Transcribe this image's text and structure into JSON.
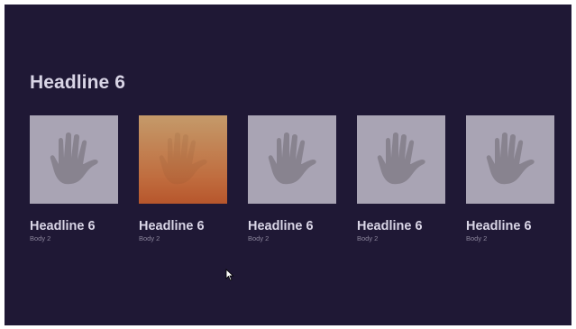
{
  "row": {
    "title": "Headline 6"
  },
  "cards": [
    {
      "title": "Headline 6",
      "body": "Body 2",
      "icon": "hand-icon",
      "focused": false
    },
    {
      "title": "Headline 6",
      "body": "Body 2",
      "icon": "hand-icon",
      "focused": true
    },
    {
      "title": "Headline 6",
      "body": "Body 2",
      "icon": "hand-icon",
      "focused": false
    },
    {
      "title": "Headline 6",
      "body": "Body 2",
      "icon": "hand-icon",
      "focused": false
    },
    {
      "title": "Headline 6",
      "body": "Body 2",
      "icon": "hand-icon",
      "focused": false
    }
  ],
  "colors": {
    "background": "#1f1835",
    "card_placeholder": "#a9a4b4",
    "focused_gradient_top": "#c49a6a",
    "focused_gradient_bottom": "#b7562c",
    "headline_text": "#d9d5e6",
    "body_text": "#8c869c"
  },
  "cursor": {
    "icon": "mouse-pointer-icon"
  }
}
